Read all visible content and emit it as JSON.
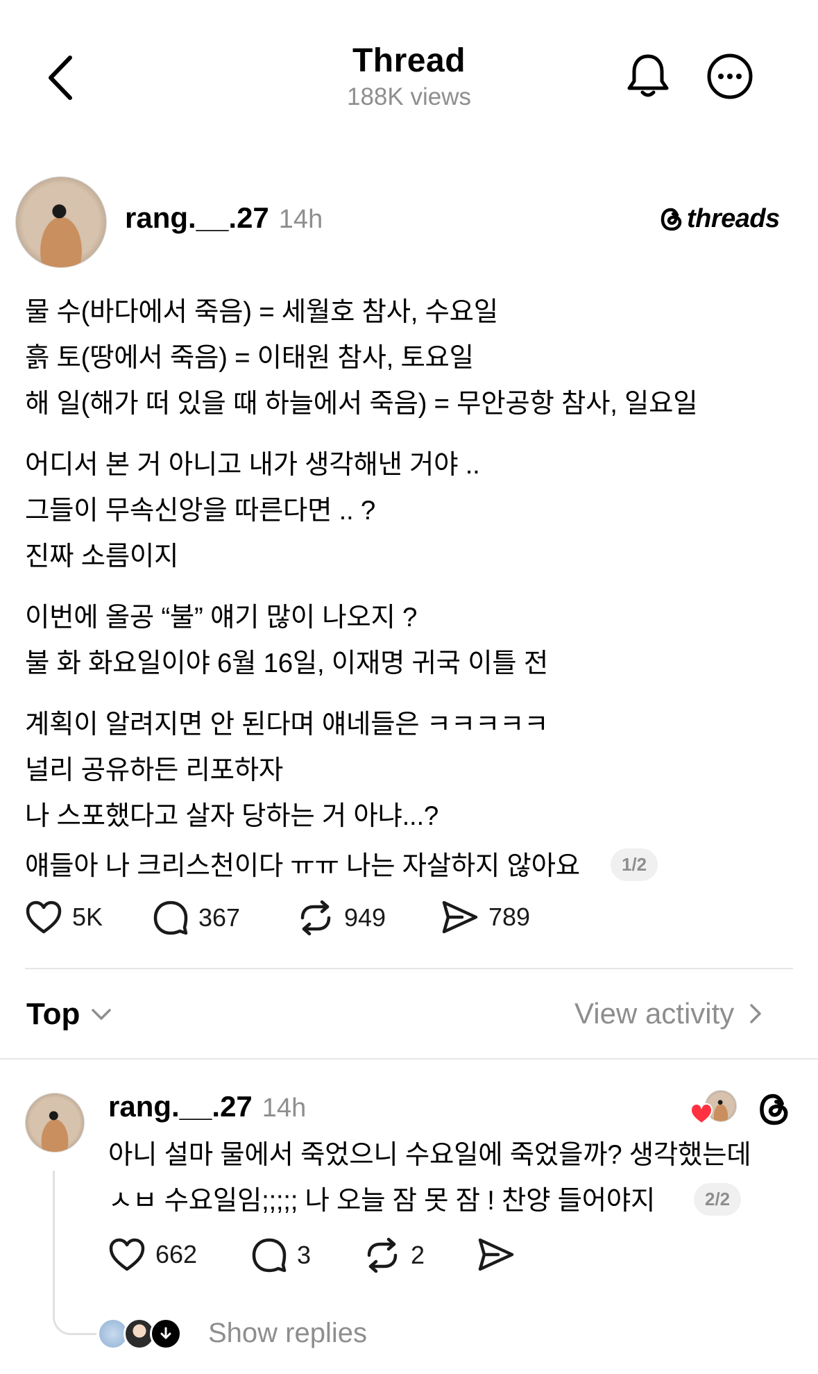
{
  "header": {
    "title": "Thread",
    "views": "188K views"
  },
  "post": {
    "username": "rang.__.27",
    "time": "14h",
    "brand": "threads",
    "lines": [
      "물 수(바다에서 죽음) = 세월호 참사, 수요일",
      "흙 토(땅에서 죽음) = 이태원 참사, 토요일",
      "해 일(해가 떠 있을 때 하늘에서 죽음) = 무안공항 참사, 일요일",
      "어디서 본 거 아니고 내가 생각해낸 거야 ..",
      "그들이 무속신앙을 따른다면 .. ?",
      "진짜 소름이지",
      "이번에 올공 “불” 얘기 많이 나오지 ?",
      "불 화 화요일이야 6월 16일, 이재명 귀국 이틀 전",
      "계획이 알려지면 안 된다며 얘네들은 ㅋㅋㅋㅋㅋ",
      "널리 공유하든 리포하자",
      "나 스포했다고 살자 당하는 거 아냐...?",
      "얘들아 나 크리스천이다 ㅠㅠ 나는 자살하지 않아요"
    ],
    "page_indicator": "1/2",
    "likes": "5K",
    "comments": "367",
    "reposts": "949",
    "shares": "789"
  },
  "sort": {
    "label": "Top",
    "view_activity": "View activity"
  },
  "reply": {
    "username": "rang.__.27",
    "time": "14h",
    "lines": [
      "아니 설마 물에서 죽었으니 수요일에 죽었을까? 생각했는데",
      "ㅅㅂ 수요일임;;;;; 나 오늘 잠 못 잠 ! 찬양 들어야지"
    ],
    "page_indicator": "2/2",
    "likes": "662",
    "comments": "3",
    "reposts": "2",
    "show_replies": "Show replies"
  },
  "colors": {
    "text": "#000000",
    "muted": "#8e8e8e",
    "heart_red": "#ff3040",
    "divider": "#e6e6e6"
  }
}
